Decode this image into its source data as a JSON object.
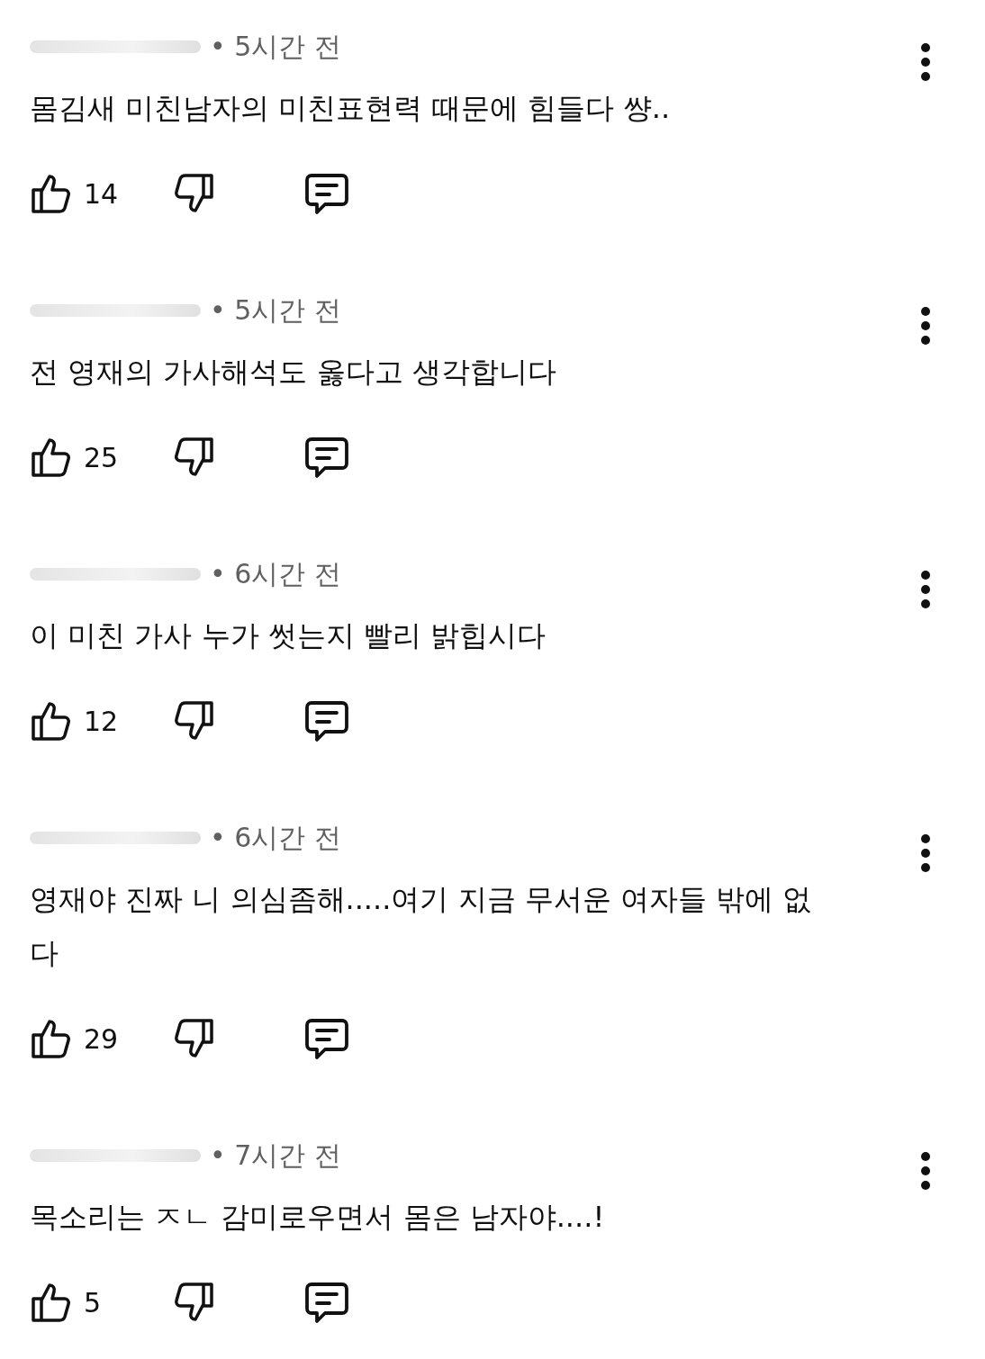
{
  "comments": [
    {
      "time": "• 5시간 전",
      "text": "몸김새 미친남자의 미친표현력 때문에 힘들다 썅..",
      "likes": "14"
    },
    {
      "time": "• 5시간 전",
      "text": "전 영재의 가사해석도 옳다고 생각합니다",
      "likes": "25"
    },
    {
      "time": "• 6시간 전",
      "text": "이 미친 가사 누가 썻는지 빨리 밝힙시다",
      "likes": "12"
    },
    {
      "time": "• 6시간 전",
      "text": "영재야 진짜 니 의심좀해.....여기 지금 무서운 여자들 밖에 없다",
      "likes": "29"
    },
    {
      "time": "• 7시간 전",
      "text": "목소리는 ㅈㄴ 감미로우면서 몸은 남자야....!",
      "likes": "5"
    }
  ]
}
